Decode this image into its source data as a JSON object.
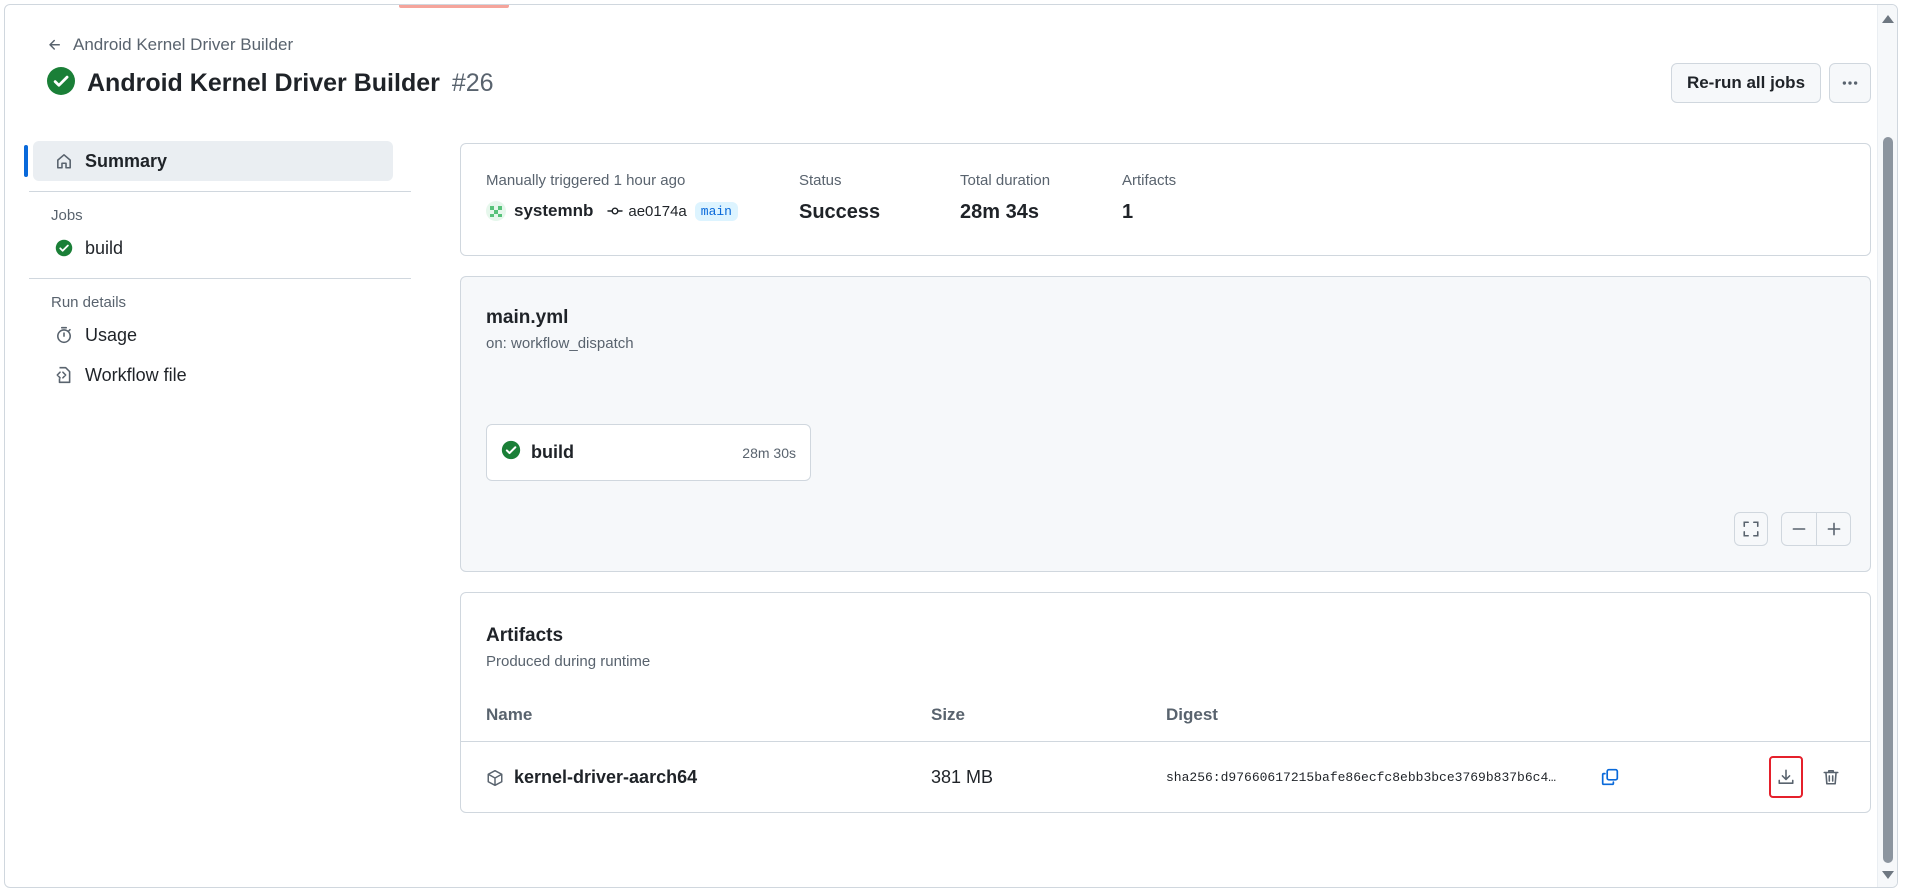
{
  "header": {
    "back_label": "Android Kernel Driver Builder",
    "workflow_name": "Android Kernel Driver Builder",
    "run_number": "#26",
    "rerun_label": "Re-run all jobs"
  },
  "sidebar": {
    "summary_label": "Summary",
    "jobs_heading": "Jobs",
    "jobs": [
      {
        "label": "build"
      }
    ],
    "run_details_heading": "Run details",
    "details": [
      {
        "label": "Usage"
      },
      {
        "label": "Workflow file"
      }
    ]
  },
  "summary": {
    "trigger_label": "Manually triggered 1 hour ago",
    "actor": "systemnb",
    "commit": "ae0174a",
    "branch": "main",
    "status_label": "Status",
    "status_value": "Success",
    "duration_label": "Total duration",
    "duration_value": "28m 34s",
    "artifacts_label": "Artifacts",
    "artifacts_value": "1"
  },
  "graph": {
    "file_name": "main.yml",
    "trigger": "on: workflow_dispatch",
    "job_name": "build",
    "job_duration": "28m 30s"
  },
  "artifacts": {
    "title": "Artifacts",
    "subtitle": "Produced during runtime",
    "columns": {
      "name": "Name",
      "size": "Size",
      "digest": "Digest"
    },
    "rows": [
      {
        "name": "kernel-driver-aarch64",
        "size": "381 MB",
        "digest": "sha256:d97660617215bafe86ecfc8ebb3bce3769b837b6c4…"
      }
    ]
  },
  "colors": {
    "success": "#1a7f37",
    "accent": "#0969da",
    "highlight": "#e5202b"
  }
}
